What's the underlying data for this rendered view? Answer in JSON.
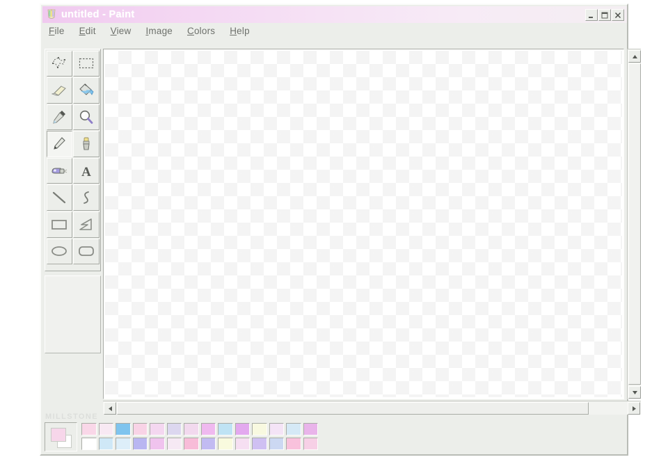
{
  "window": {
    "title": "untitled - Paint",
    "icon": "paint-palette-icon",
    "controls": [
      {
        "name": "minimize-button",
        "glyph": "minimize-icon"
      },
      {
        "name": "maximize-button",
        "glyph": "maximize-icon"
      },
      {
        "name": "close-button",
        "glyph": "close-icon"
      }
    ]
  },
  "menu": {
    "items": [
      {
        "label": "File",
        "accel": "F"
      },
      {
        "label": "Edit",
        "accel": "E"
      },
      {
        "label": "View",
        "accel": "V"
      },
      {
        "label": "Image",
        "accel": "I"
      },
      {
        "label": "Colors",
        "accel": "C"
      },
      {
        "label": "Help",
        "accel": "H"
      }
    ]
  },
  "toolbox": {
    "tools": [
      {
        "name": "free-form-select-tool",
        "icon": "free-form-select-icon",
        "selected": false
      },
      {
        "name": "rectangle-select-tool",
        "icon": "rectangle-select-icon",
        "selected": false
      },
      {
        "name": "eraser-tool",
        "icon": "eraser-icon",
        "selected": false
      },
      {
        "name": "fill-tool",
        "icon": "paint-bucket-icon",
        "selected": false
      },
      {
        "name": "pick-color-tool",
        "icon": "eyedropper-icon",
        "selected": false
      },
      {
        "name": "magnifier-tool",
        "icon": "magnifier-icon",
        "selected": false
      },
      {
        "name": "pencil-tool",
        "icon": "pencil-icon",
        "selected": true
      },
      {
        "name": "brush-tool",
        "icon": "paintbrush-icon",
        "selected": false
      },
      {
        "name": "airbrush-tool",
        "icon": "airbrush-icon",
        "selected": false
      },
      {
        "name": "text-tool",
        "icon": "text-a-icon",
        "selected": false
      },
      {
        "name": "line-tool",
        "icon": "line-icon",
        "selected": false
      },
      {
        "name": "curve-tool",
        "icon": "curve-icon",
        "selected": false
      },
      {
        "name": "rectangle-tool",
        "icon": "rectangle-icon",
        "selected": false
      },
      {
        "name": "polygon-tool",
        "icon": "polygon-icon",
        "selected": false
      },
      {
        "name": "ellipse-tool",
        "icon": "ellipse-icon",
        "selected": false
      },
      {
        "name": "rounded-rectangle-tool",
        "icon": "rounded-rectangle-icon",
        "selected": false
      }
    ]
  },
  "watermark": {
    "text": "MILLSTONE"
  },
  "colors": {
    "foreground": "#f7d6ea",
    "background": "#ffffff",
    "palette_row1": [
      "#f9d7e8",
      "#f8e9f3",
      "#7fc4ee",
      "#f8d3e6",
      "#f4d7f0",
      "#dcd7ef",
      "#f2d9ee",
      "#efb9ef",
      "#bfe3f4",
      "#e3a9ef",
      "#f8f9e0",
      "#f4e4f6",
      "#d5e9f6",
      "#e9b4ea"
    ],
    "palette_row2": [
      "#ffffff",
      "#cfe8f7",
      "#ddeef9",
      "#b9b6f1",
      "#f0c3ee",
      "#f6e9f4",
      "#f8bcd8",
      "#c2bbf2",
      "#f9fade",
      "#f6dff2",
      "#cfc0f2",
      "#ccd8f2",
      "#f9c1dc",
      "#f7d0e6"
    ]
  },
  "canvas": {
    "name": "drawing-canvas"
  },
  "scrollbars": {
    "vertical": {
      "up": "scroll-up-icon",
      "down": "scroll-down-icon"
    },
    "horizontal": {
      "left": "scroll-left-icon",
      "right": "scroll-right-icon"
    }
  }
}
